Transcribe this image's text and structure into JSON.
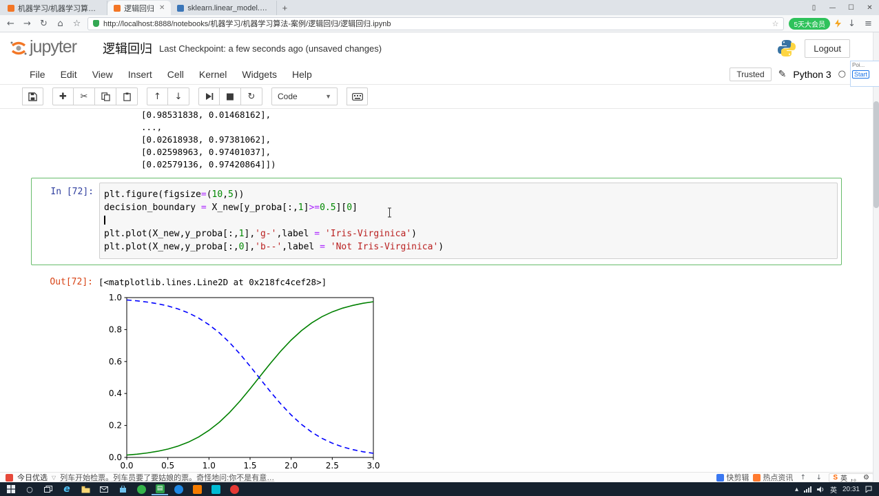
{
  "browser": {
    "tabs": [
      {
        "title": "机器学习/机器学习算法-案例/逻…"
      },
      {
        "title": "逻辑回归"
      },
      {
        "title": "sklearn.linear_model.Logistic…"
      }
    ],
    "url": "http://localhost:8888/notebooks/机器学习/机器学习算法-案例/逻辑回归/逻辑回归.ipynb",
    "member_badge": "5天大会员"
  },
  "jupyter": {
    "logo_text": "jupyter",
    "notebook_title": "逻辑回归",
    "checkpoint": "Last Checkpoint: a few seconds ago (unsaved changes)",
    "logout_label": "Logout",
    "menus": [
      "File",
      "Edit",
      "View",
      "Insert",
      "Cell",
      "Kernel",
      "Widgets",
      "Help"
    ],
    "trusted_label": "Trusted",
    "kernel_name": "Python 3",
    "toolbar": {
      "cell_type": "Code"
    }
  },
  "overlay": {
    "title": "Poi...",
    "button": "Start"
  },
  "notebook": {
    "prev_output_lines": [
      "[0.98531838, 0.01468162],",
      "...,",
      "[0.02618938, 0.97381062],",
      "[0.02598963, 0.97401037],",
      "[0.02579136, 0.97420864]])"
    ],
    "cell": {
      "prompt_in": "In [72]:",
      "prompt_out": "Out[72]:",
      "output_text": "[<matplotlib.lines.Line2D at 0x218fc4cef28>]",
      "code_lines": [
        [
          {
            "t": "plt.figure(figsize",
            "c": "p"
          },
          {
            "t": "=",
            "c": "o"
          },
          {
            "t": "(",
            "c": "p"
          },
          {
            "t": "10",
            "c": "n"
          },
          {
            "t": ",",
            "c": "p"
          },
          {
            "t": "5",
            "c": "n"
          },
          {
            "t": "))",
            "c": "p"
          }
        ],
        [
          {
            "t": "decision_boundary ",
            "c": "p"
          },
          {
            "t": "=",
            "c": "o"
          },
          {
            "t": " X_new[y_proba[:,",
            "c": "p"
          },
          {
            "t": "1",
            "c": "n"
          },
          {
            "t": "]",
            "c": "p"
          },
          {
            "t": ">=",
            "c": "o"
          },
          {
            "t": "0.5",
            "c": "n"
          },
          {
            "t": "][",
            "c": "p"
          },
          {
            "t": "0",
            "c": "n"
          },
          {
            "t": "]",
            "c": "p"
          }
        ],
        [],
        [
          {
            "t": "plt.plot(X_new,y_proba[:,",
            "c": "p"
          },
          {
            "t": "1",
            "c": "n"
          },
          {
            "t": "],",
            "c": "p"
          },
          {
            "t": "'g-'",
            "c": "s"
          },
          {
            "t": ",label ",
            "c": "p"
          },
          {
            "t": "=",
            "c": "o"
          },
          {
            "t": " ",
            "c": "p"
          },
          {
            "t": "'Iris-Virginica'",
            "c": "s"
          },
          {
            "t": ")",
            "c": "p"
          }
        ],
        [
          {
            "t": "plt.plot(X_new,y_proba[:,",
            "c": "p"
          },
          {
            "t": "0",
            "c": "n"
          },
          {
            "t": "],",
            "c": "p"
          },
          {
            "t": "'b--'",
            "c": "s"
          },
          {
            "t": ",label ",
            "c": "p"
          },
          {
            "t": "=",
            "c": "o"
          },
          {
            "t": " ",
            "c": "p"
          },
          {
            "t": "'Not Iris-Virginica'",
            "c": "s"
          },
          {
            "t": ")",
            "c": "p"
          }
        ]
      ]
    }
  },
  "chart_data": {
    "type": "line",
    "title": "",
    "xlabel": "",
    "ylabel": "",
    "grid": false,
    "legend": "none",
    "xlim": [
      0.0,
      3.0
    ],
    "ylim": [
      0.0,
      1.0
    ],
    "xticks": [
      0.0,
      0.5,
      1.0,
      1.5,
      2.0,
      2.5,
      3.0
    ],
    "yticks": [
      0.0,
      0.2,
      0.4,
      0.6,
      0.8,
      1.0
    ],
    "x": [
      0.0,
      0.125,
      0.25,
      0.375,
      0.5,
      0.625,
      0.75,
      0.875,
      1.0,
      1.125,
      1.25,
      1.375,
      1.5,
      1.625,
      1.75,
      1.875,
      2.0,
      2.125,
      2.25,
      2.375,
      2.5,
      2.625,
      2.75,
      2.875,
      3.0
    ],
    "series": [
      {
        "name": "Iris-Virginica",
        "style": "solid",
        "color": "#008000",
        "values": [
          0.0147,
          0.0203,
          0.0279,
          0.0383,
          0.0523,
          0.071,
          0.0956,
          0.1281,
          0.1692,
          0.22,
          0.281,
          0.3513,
          0.4287,
          0.5098,
          0.5903,
          0.6664,
          0.7346,
          0.7931,
          0.8416,
          0.8805,
          0.9107,
          0.9339,
          0.9514,
          0.9645,
          0.9741
        ]
      },
      {
        "name": "Not Iris-Virginica",
        "style": "dashed",
        "color": "#0000ff",
        "dash": "7 5",
        "values": [
          0.9853,
          0.9797,
          0.9721,
          0.9617,
          0.9477,
          0.929,
          0.9044,
          0.8719,
          0.8308,
          0.78,
          0.719,
          0.6487,
          0.5713,
          0.4902,
          0.4097,
          0.3336,
          0.2654,
          0.2069,
          0.1584,
          0.1195,
          0.0893,
          0.0661,
          0.0486,
          0.0355,
          0.0259
        ]
      }
    ]
  },
  "ticker": {
    "source": "今日优选",
    "text": "列车开始检票。列车员要了要姑娘的票。奇怪地问:你不是有意…",
    "tools": [
      {
        "label": "快剪辑"
      },
      {
        "label": "热点资讯"
      }
    ],
    "ime": {
      "logo": "S",
      "mode": "英",
      "punct": "，。"
    }
  },
  "taskbar": {
    "lang": "英",
    "time": "20:31"
  }
}
